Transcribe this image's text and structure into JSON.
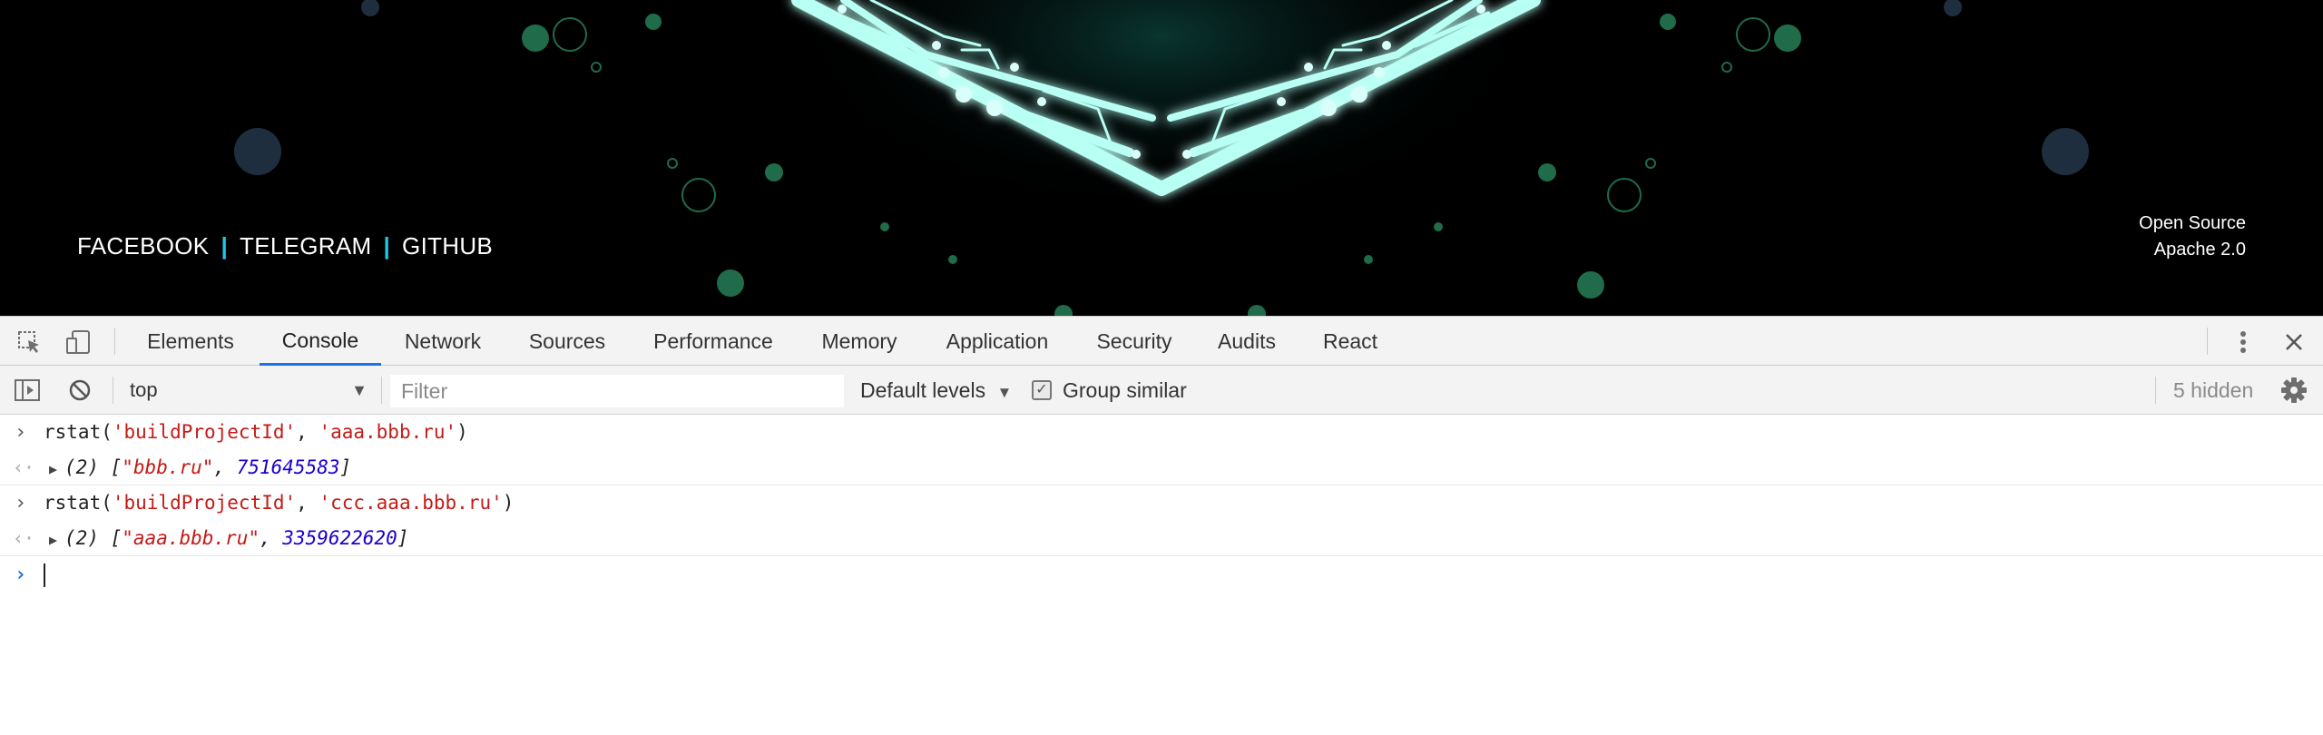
{
  "website": {
    "social_links": [
      "FACEBOOK",
      "TELEGRAM",
      "GITHUB"
    ],
    "separator": "|",
    "license_line1": "Open Source",
    "license_line2": "Apache 2.0",
    "accent_color": "#1ec8e8",
    "glow_color": "#4ff5e0"
  },
  "devtools": {
    "tabs": [
      "Elements",
      "Console",
      "Network",
      "Sources",
      "Performance",
      "Memory",
      "Application",
      "Security",
      "Audits",
      "React"
    ],
    "active_tab": "Console",
    "icons": {
      "inspect": "inspect-element-icon",
      "device": "device-toolbar-icon",
      "more": "more-vertical-icon",
      "close": "close-icon"
    },
    "console_toolbar": {
      "context": "top",
      "filter_placeholder": "Filter",
      "levels": "Default levels",
      "group_similar": "Group similar",
      "group_similar_checked": true,
      "hidden": "5 hidden"
    },
    "console": {
      "entries": [
        {
          "input": {
            "fn": "rstat(",
            "arg1": "'buildProjectId'",
            "comma": ", ",
            "arg2": "'aaa.bbb.ru'",
            "close": ")"
          },
          "result": {
            "count": "(2)",
            "open": " [",
            "str": "\"bbb.ru\"",
            "comma": ", ",
            "num": "751645583",
            "close": "]"
          }
        },
        {
          "input": {
            "fn": "rstat(",
            "arg1": "'buildProjectId'",
            "comma": ", ",
            "arg2": "'ccc.aaa.bbb.ru'",
            "close": ")"
          },
          "result": {
            "count": "(2)",
            "open": " [",
            "str": "\"aaa.bbb.ru\"",
            "comma": ", ",
            "num": "3359622620",
            "close": "]"
          }
        }
      ]
    },
    "accent_color": "#1a73e8"
  }
}
